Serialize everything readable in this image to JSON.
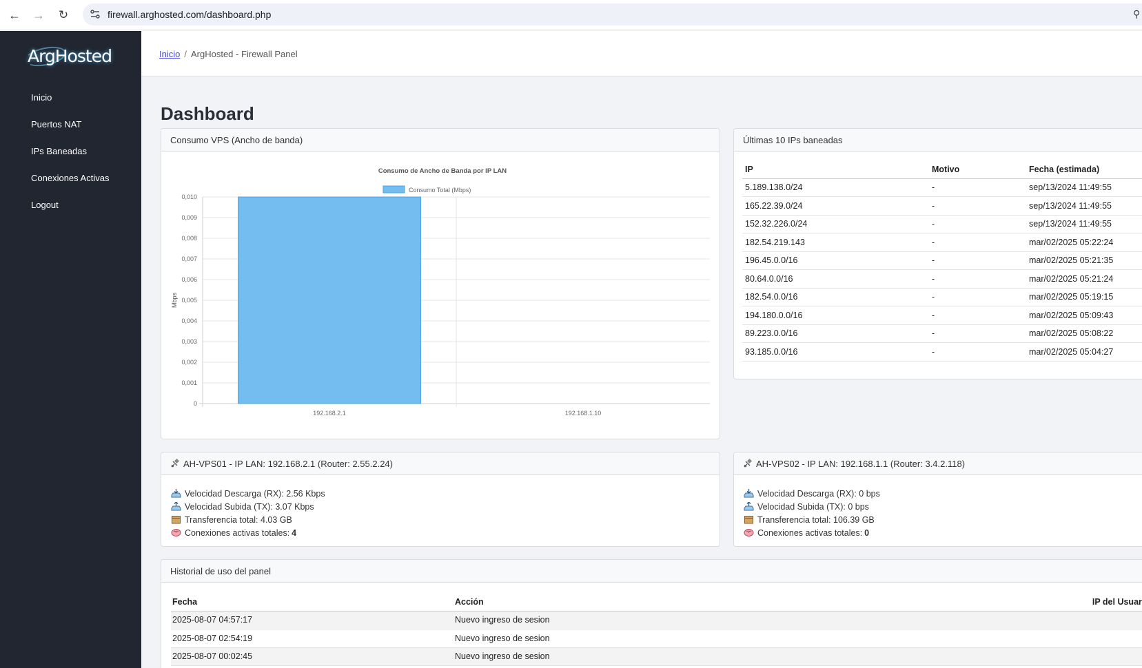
{
  "browser": {
    "url": "firewall.arghosted.com/dashboard.php"
  },
  "sidebar": {
    "logo_text": "ArgHosted",
    "items": [
      {
        "label": "Inicio"
      },
      {
        "label": "Puertos NAT"
      },
      {
        "label": "IPs Baneadas"
      },
      {
        "label": "Conexiones Activas"
      },
      {
        "label": "Logout"
      }
    ]
  },
  "breadcrumb": {
    "home": "Inicio",
    "separator": "/",
    "current": "ArgHosted - Firewall Panel"
  },
  "page": {
    "title": "Dashboard"
  },
  "bandwidth_card": {
    "header": "Consumo VPS (Ancho de banda)"
  },
  "chart_data": {
    "type": "bar",
    "title": "Consumo de Ancho de Banda por IP LAN",
    "categories": [
      "192.168.2.1",
      "192.168.1.10"
    ],
    "series": [
      {
        "name": "Consumo Total (Mbps)",
        "values": [
          0.01,
          0
        ]
      }
    ],
    "ylabel": "Mbps",
    "xlabel": "",
    "ylim": [
      0,
      0.01
    ],
    "yticks": [
      "0",
      "0,001",
      "0,002",
      "0,003",
      "0,004",
      "0,005",
      "0,006",
      "0,007",
      "0,008",
      "0,009",
      "0,010"
    ],
    "grid": true,
    "legend": "top-center",
    "colors": {
      "bar": "#74bdf0",
      "bar_border": "#4aa4e4"
    }
  },
  "banned_ips": {
    "header": "Últimas 10 IPs baneadas",
    "columns": [
      "IP",
      "Motivo",
      "Fecha (estimada)"
    ],
    "rows": [
      [
        "5.189.138.0/24",
        "-",
        "sep/13/2024 11:49:55"
      ],
      [
        "165.22.39.0/24",
        "-",
        "sep/13/2024 11:49:55"
      ],
      [
        "152.32.226.0/24",
        "-",
        "sep/13/2024 11:49:55"
      ],
      [
        "182.54.219.143",
        "-",
        "mar/02/2025 05:22:24"
      ],
      [
        "196.45.0.0/16",
        "-",
        "mar/02/2025 05:21:35"
      ],
      [
        "80.64.0.0/16",
        "-",
        "mar/02/2025 05:21:24"
      ],
      [
        "182.54.0.0/16",
        "-",
        "mar/02/2025 05:19:15"
      ],
      [
        "194.180.0.0/16",
        "-",
        "mar/02/2025 05:09:43"
      ],
      [
        "89.223.0.0/16",
        "-",
        "mar/02/2025 05:08:22"
      ],
      [
        "93.185.0.0/16",
        "-",
        "mar/02/2025 05:04:27"
      ]
    ]
  },
  "vps": [
    {
      "header": "AH-VPS01 - IP LAN: 192.168.2.1 (Router: 2.55.2.24)",
      "rx": "Velocidad Descarga (RX): 2.56 Kbps",
      "tx": "Velocidad Subida (TX): 3.07 Kbps",
      "transfer": "Transferencia total: 4.03 GB",
      "conn_label": "Conexiones activas totales:",
      "conn_value": "4"
    },
    {
      "header": "AH-VPS02 - IP LAN: 192.168.1.1 (Router: 3.4.2.118)",
      "rx": "Velocidad Descarga (RX): 0 bps",
      "tx": "Velocidad Subida (TX): 0 bps",
      "transfer": "Transferencia total: 106.39 GB",
      "conn_label": "Conexiones activas totales:",
      "conn_value": "0"
    }
  ],
  "history": {
    "header": "Historial de uso del panel",
    "columns": [
      "Fecha",
      "Acción",
      "IP del Usuario"
    ],
    "rows": [
      [
        "2025-08-07 04:57:17",
        "Nuevo ingreso de sesion",
        ""
      ],
      [
        "2025-08-07 02:54:19",
        "Nuevo ingreso de sesion",
        ""
      ],
      [
        "2025-08-07 00:02:45",
        "Nuevo ingreso de sesion",
        ""
      ]
    ]
  }
}
